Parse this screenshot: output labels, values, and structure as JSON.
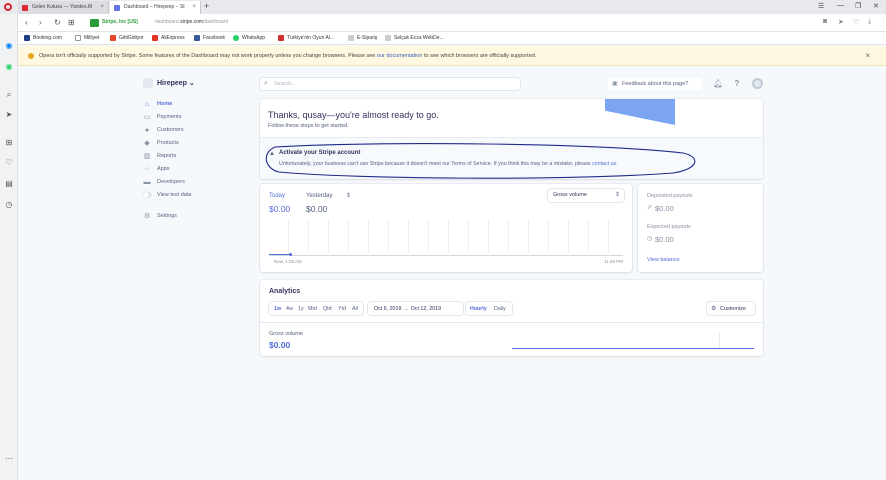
{
  "browser": {
    "tabs": [
      {
        "title": "Gelen Kutusu — Yandex.M",
        "favicon_color": "#e0262d"
      },
      {
        "title": "Dashboard – Hirepeep – St",
        "favicon_color": "#6772e5"
      }
    ],
    "new_tab": "+",
    "window_controls": [
      "☰",
      "—",
      "❐",
      "✕"
    ],
    "site_identity": "Stripe, Inc [US]",
    "url_prefix": "dashboard.",
    "url_domain": "stripe.com",
    "url_path": "/dashboard",
    "bookmarks": [
      {
        "label": "Booking.com",
        "color": "#1f3c88"
      },
      {
        "label": "Milliyet",
        "color": "#ffffff"
      },
      {
        "label": "GittiGidiyor",
        "color": "#e8442c"
      },
      {
        "label": "AliExpress",
        "color": "#e43225"
      },
      {
        "label": "Facebook",
        "color": "#3b5998"
      },
      {
        "label": "WhatsApp",
        "color": "#25d366"
      },
      {
        "label": "Türkiye'nin Oyun Al...",
        "color": "#d32f2f"
      },
      {
        "label": "E-Sipariş",
        "color": "#cccccc"
      },
      {
        "label": "Selçuk Ecza WebDe...",
        "color": "#cccccc"
      }
    ]
  },
  "notice": {
    "text_before": "Opera isn't officially supported by Stripe. Some features of the Dashboard may not work properly unless you change browsers. Please see ",
    "link": "our documentation",
    "text_after": " to see which browsers are officially supported."
  },
  "nav": {
    "account": "Hirepeep",
    "items": [
      {
        "label": "Home",
        "icon": "home-icon",
        "glyph": "⌂"
      },
      {
        "label": "Payments",
        "icon": "payments-icon",
        "glyph": "▭"
      },
      {
        "label": "Customers",
        "icon": "customers-icon",
        "glyph": "●"
      },
      {
        "label": "Products",
        "icon": "products-icon",
        "glyph": "◆"
      },
      {
        "label": "Reports",
        "icon": "reports-icon",
        "glyph": "▥"
      },
      {
        "label": "Apps",
        "icon": "apps-icon",
        "glyph": "⁘"
      },
      {
        "label": "Developers",
        "icon": "developers-icon",
        "glyph": "▬"
      },
      {
        "label": "View test data",
        "icon": "toggle",
        "glyph": ""
      },
      {
        "label": "Settings",
        "icon": "settings-icon",
        "glyph": "⚙"
      }
    ]
  },
  "topbar": {
    "search_placeholder": "Search...",
    "feedback": "Feedback about this page?"
  },
  "onboarding": {
    "title": "Thanks, qusay—you're almost ready to go.",
    "subtitle": "Follow these steps to get started.",
    "activate_title": "Activate your Stripe account",
    "activate_msg": "Unfortunately, your business can't use Stripe because it doesn't meet our Terms of Service. If you think this may be a mistake, please ",
    "activate_link": "contact us."
  },
  "volume": {
    "today_label": "Today",
    "yesterday_label": "Yesterday",
    "yesterday_caret": "⇕",
    "today_amount": "$0.00",
    "yesterday_amount": "$0.00",
    "metric": "Gross volume",
    "axis_start": "Now, 1:25 AM",
    "axis_end": "11:59 PM"
  },
  "payouts": {
    "deposited_label": "Deposited payouts",
    "deposited_amount": "$0.00",
    "expected_label": "Expected payouts",
    "expected_amount": "$0.00",
    "view_balance": "View balance"
  },
  "analytics": {
    "title": "Analytics",
    "ranges": [
      "1w",
      "4w",
      "1y",
      "Mtd",
      "Qtd",
      "Ytd",
      "All"
    ],
    "selected_range": "1w",
    "date_from": "Oct 6, 2019",
    "date_arrow": "→",
    "date_to": "Oct 12, 2019",
    "interval_selected": "Hourly",
    "interval_other": "Daily",
    "customize": "Customize",
    "metric_label": "Gross volume",
    "metric_value": "$0.00"
  },
  "colors": {
    "accent": "#556cd6",
    "ink": "#1f2a8a"
  }
}
